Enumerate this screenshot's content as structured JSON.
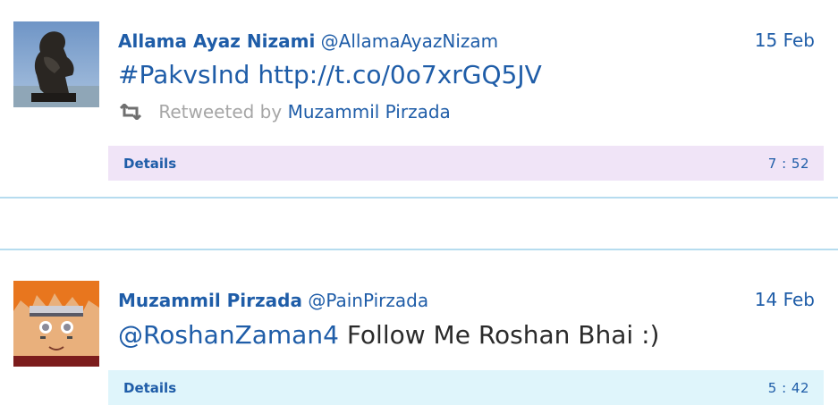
{
  "tweets": [
    {
      "author_name": "Allama Ayaz Nizami",
      "handle": "@AllamaAyazNizam",
      "date": "15 Feb",
      "text_parts": [
        "#PakvsInd",
        "http://t.co/0o7xrGQ5JV"
      ],
      "retweet_label": "Retweeted by",
      "retweeted_by": "Muzammil Pirzada",
      "details_label": "Details",
      "details_time": "7 : 52",
      "details_bg": "#f0e4f7",
      "avatar": "thinker-statue-image"
    },
    {
      "author_name": "Muzammil Pirzada",
      "handle": "@PainPirzada",
      "date": "14 Feb",
      "mention": "@RoshanZaman4",
      "text_rest": "Follow Me Roshan Bhai :)",
      "details_label": "Details",
      "details_time": "5 : 42",
      "details_bg": "#dff5fb",
      "avatar": "anime-character-image"
    }
  ],
  "colors": {
    "link": "#1f5da8",
    "text": "#2b2b2b",
    "muted": "#a6a6a6",
    "separator": "#b6dcef"
  },
  "icons": {
    "retweet": "retweet-icon"
  }
}
